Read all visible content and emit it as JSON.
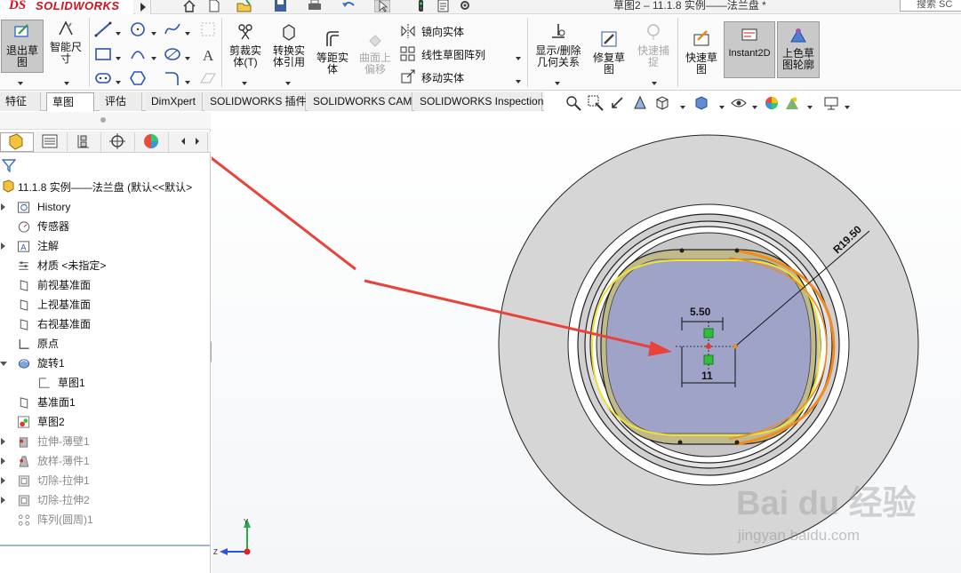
{
  "app": {
    "brand_ds": "DS",
    "brand_name": "SOLIDWORKS",
    "doc_title": "草图2 – 11.1.8  实例——法兰盘 *",
    "search_placeholder": "搜索 SC"
  },
  "ribbon": {
    "exit_sketch": "退出草图",
    "smart_dim": "智能尺寸",
    "trim": "剪裁实体(T)",
    "convert": "转换实体引用",
    "offset": "等距实体",
    "surface_offset": "曲面上偏移",
    "mirror": "镜向实体",
    "linear_pattern": "线性草图阵列",
    "move": "移动实体",
    "display_relations": "显示/删除几何关系",
    "repair": "修复草图",
    "quick_snaps": "快速捕捉",
    "rapid_sketch": "快速草图",
    "instant2d": "Instant2D",
    "shaded_contours": "上色草图轮廓"
  },
  "tabs": [
    {
      "label": "特征"
    },
    {
      "label": "草图"
    },
    {
      "label": "评估"
    },
    {
      "label": "DimXpert"
    },
    {
      "label": "SOLIDWORKS 插件"
    },
    {
      "label": "SOLIDWORKS CAM"
    },
    {
      "label": "SOLIDWORKS Inspection"
    }
  ],
  "tree": {
    "root": "11.1.8  实例——法兰盘  (默认<<默认>",
    "items": [
      {
        "label": "History",
        "icon": "history-icon",
        "expand": "collapsed",
        "suppressed": false
      },
      {
        "label": "传感器",
        "icon": "sensor-icon",
        "expand": "none",
        "suppressed": false
      },
      {
        "label": "注解",
        "icon": "annotation-icon",
        "expand": "collapsed",
        "suppressed": false
      },
      {
        "label": "材质 <未指定>",
        "icon": "material-icon",
        "expand": "none",
        "suppressed": false
      },
      {
        "label": "前视基准面",
        "icon": "plane-icon",
        "expand": "none",
        "suppressed": false
      },
      {
        "label": "上视基准面",
        "icon": "plane-icon",
        "expand": "none",
        "suppressed": false
      },
      {
        "label": "右视基准面",
        "icon": "plane-icon",
        "expand": "none",
        "suppressed": false
      },
      {
        "label": "原点",
        "icon": "origin-icon",
        "expand": "none",
        "suppressed": false
      },
      {
        "label": "旋转1",
        "icon": "revolve-icon",
        "expand": "expanded",
        "suppressed": false
      },
      {
        "label": "草图1",
        "icon": "sketch-icon",
        "expand": "none",
        "suppressed": false,
        "child": true
      },
      {
        "label": "基准面1",
        "icon": "plane-icon",
        "expand": "none",
        "suppressed": false
      },
      {
        "label": "草图2",
        "icon": "active-sketch-icon",
        "expand": "none",
        "suppressed": false
      },
      {
        "label": "拉伸-薄壁1",
        "icon": "extrude-icon",
        "expand": "collapsed",
        "suppressed": true
      },
      {
        "label": "放样-薄件1",
        "icon": "loft-icon",
        "expand": "collapsed",
        "suppressed": true
      },
      {
        "label": "切除-拉伸1",
        "icon": "cut-icon",
        "expand": "collapsed",
        "suppressed": true
      },
      {
        "label": "切除-拉伸2",
        "icon": "cut-icon",
        "expand": "collapsed",
        "suppressed": true
      },
      {
        "label": "阵列(圆周)1",
        "icon": "pattern-icon",
        "expand": "none",
        "suppressed": true
      }
    ]
  },
  "drawing": {
    "dim_radius": "R19.50",
    "dim_top": "5.50",
    "dim_bottom": "11",
    "axis_y": "Y",
    "axis_z": "Z"
  },
  "watermark": {
    "line1": "Bai du 经验",
    "line2": "jingyan.baidu.com"
  },
  "colors": {
    "annotation_arrow": "#e8423a",
    "sketch_yellow": "#f0e233",
    "sketch_orange": "#f28a1e",
    "part_gray": "#d6d6d6",
    "face_purple": "#9fa3c8"
  }
}
